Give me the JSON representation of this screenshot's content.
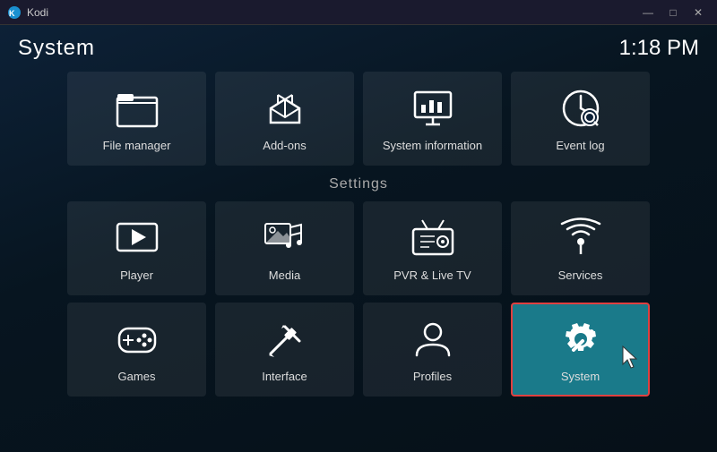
{
  "titlebar": {
    "app_name": "Kodi",
    "minimize_label": "—",
    "maximize_label": "□",
    "close_label": "✕"
  },
  "header": {
    "page_title": "System",
    "clock": "1:18 PM"
  },
  "top_row": {
    "items": [
      {
        "id": "file-manager",
        "label": "File manager"
      },
      {
        "id": "add-ons",
        "label": "Add-ons"
      },
      {
        "id": "system-information",
        "label": "System information"
      },
      {
        "id": "event-log",
        "label": "Event log"
      }
    ]
  },
  "settings_section": {
    "label": "Settings",
    "rows": [
      [
        {
          "id": "player",
          "label": "Player"
        },
        {
          "id": "media",
          "label": "Media"
        },
        {
          "id": "pvr-live-tv",
          "label": "PVR & Live TV"
        },
        {
          "id": "services",
          "label": "Services"
        }
      ],
      [
        {
          "id": "games",
          "label": "Games"
        },
        {
          "id": "interface",
          "label": "Interface"
        },
        {
          "id": "profiles",
          "label": "Profiles"
        },
        {
          "id": "system",
          "label": "System",
          "selected": true
        }
      ]
    ]
  }
}
